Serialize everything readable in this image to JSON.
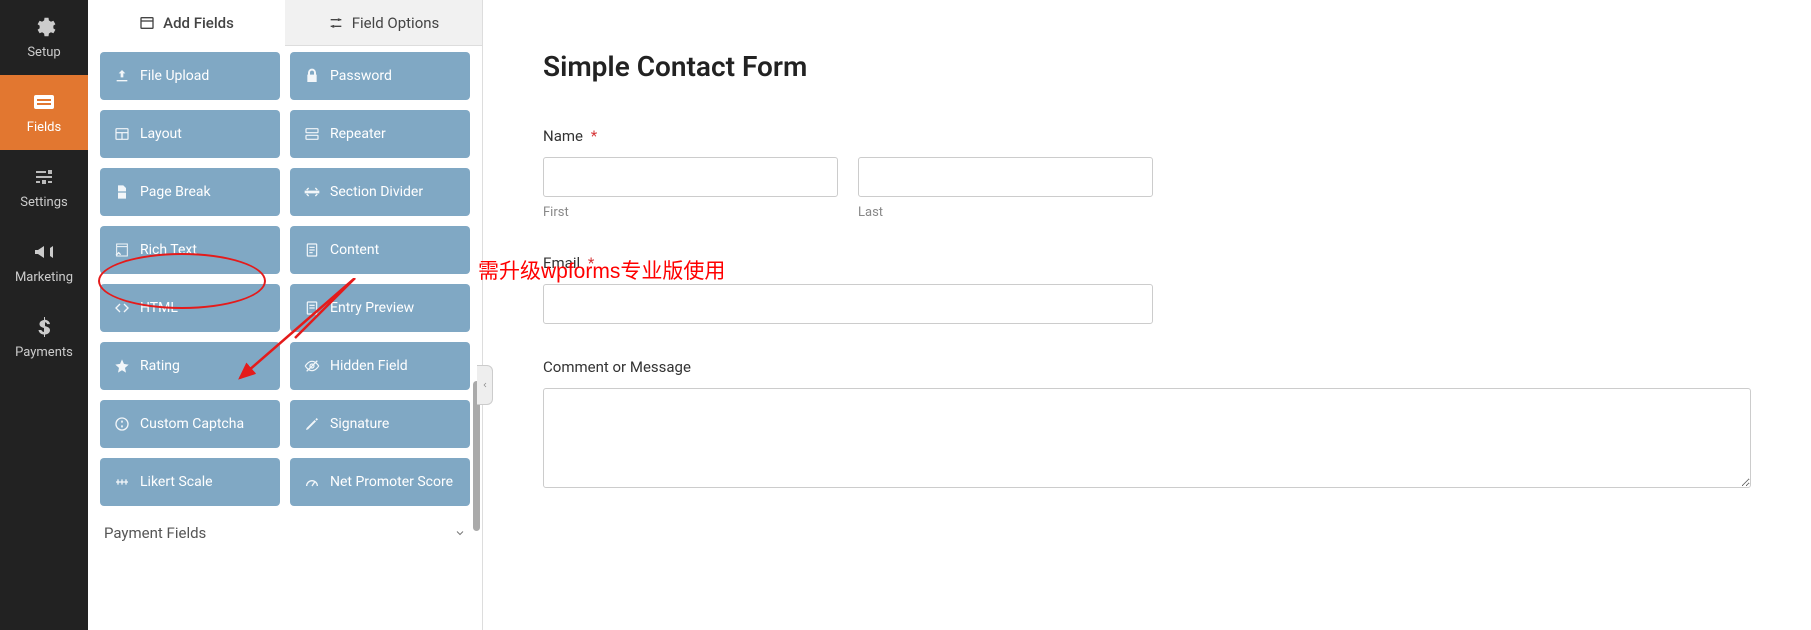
{
  "nav": [
    {
      "id": "setup",
      "label": "Setup",
      "icon": "gear"
    },
    {
      "id": "fields",
      "label": "Fields",
      "icon": "list"
    },
    {
      "id": "settings",
      "label": "Settings",
      "icon": "sliders"
    },
    {
      "id": "marketing",
      "label": "Marketing",
      "icon": "bullhorn"
    },
    {
      "id": "payments",
      "label": "Payments",
      "icon": "dollar"
    }
  ],
  "panel_tabs": {
    "add": "Add Fields",
    "options": "Field Options"
  },
  "fields": [
    {
      "label": "File Upload",
      "icon": "upload"
    },
    {
      "label": "Password",
      "icon": "lock"
    },
    {
      "label": "Layout",
      "icon": "layout"
    },
    {
      "label": "Repeater",
      "icon": "repeater"
    },
    {
      "label": "Page Break",
      "icon": "pagebreak"
    },
    {
      "label": "Section Divider",
      "icon": "divider"
    },
    {
      "label": "Rich Text",
      "icon": "richtext"
    },
    {
      "label": "Content",
      "icon": "content"
    },
    {
      "label": "HTML",
      "icon": "code"
    },
    {
      "label": "Entry Preview",
      "icon": "preview"
    },
    {
      "label": "Rating",
      "icon": "star"
    },
    {
      "label": "Hidden Field",
      "icon": "hidden"
    },
    {
      "label": "Custom Captcha",
      "icon": "captcha"
    },
    {
      "label": "Signature",
      "icon": "pencil"
    },
    {
      "label": "Likert Scale",
      "icon": "likert"
    },
    {
      "label": "Net Promoter Score",
      "icon": "gauge"
    }
  ],
  "section": "Payment Fields",
  "annotation": "需升级wpforms专业版使用",
  "form": {
    "title": "Simple Contact Form",
    "name_label": "Name",
    "first_label": "First",
    "last_label": "Last",
    "email_label": "Email",
    "message_label": "Comment or Message",
    "required": "*"
  }
}
